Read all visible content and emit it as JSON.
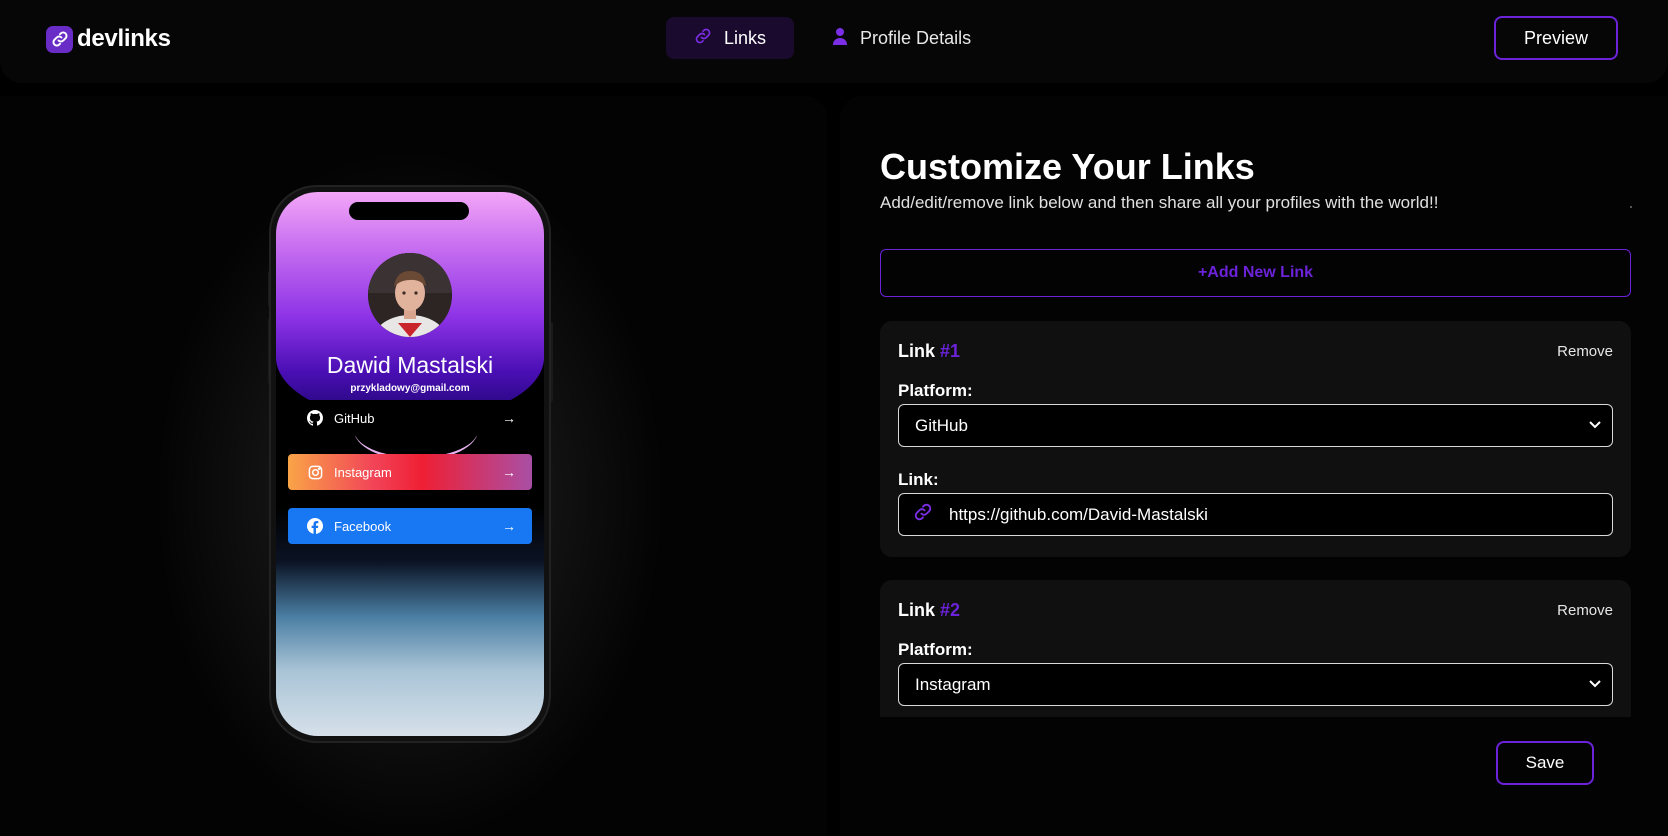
{
  "app": {
    "name": "devlinks"
  },
  "nav": {
    "tabs": [
      {
        "label": "Links",
        "icon": "link-icon",
        "active": true
      },
      {
        "label": "Profile Details",
        "icon": "user-icon",
        "active": false
      }
    ],
    "preview_label": "Preview"
  },
  "preview": {
    "name": "Dawid Mastalski",
    "email": "przykladowy@gmail.com",
    "links": [
      {
        "platform": "GitHub",
        "icon": "github-icon",
        "color": "#000000"
      },
      {
        "platform": "Instagram",
        "icon": "instagram-icon",
        "color": "#f24458"
      },
      {
        "platform": "Facebook",
        "icon": "facebook-icon",
        "color": "#1877f2"
      }
    ]
  },
  "editor": {
    "title": "Customize Your Links",
    "subtitle": "Add/edit/remove link below and then share all your profiles with the world!!",
    "add_label": "+Add New Link",
    "save_label": "Save",
    "links": [
      {
        "title": "Link",
        "number": "#1",
        "remove_label": "Remove",
        "platform_label": "Platform:",
        "platform": "GitHub",
        "link_label": "Link:",
        "url": "https://github.com/David-Mastalski"
      },
      {
        "title": "Link",
        "number": "#2",
        "remove_label": "Remove",
        "platform_label": "Platform:",
        "platform": "Instagram"
      }
    ]
  },
  "colors": {
    "accent": "#6b22d8",
    "background": "#000000",
    "panel": "#030303",
    "card": "#101010"
  }
}
